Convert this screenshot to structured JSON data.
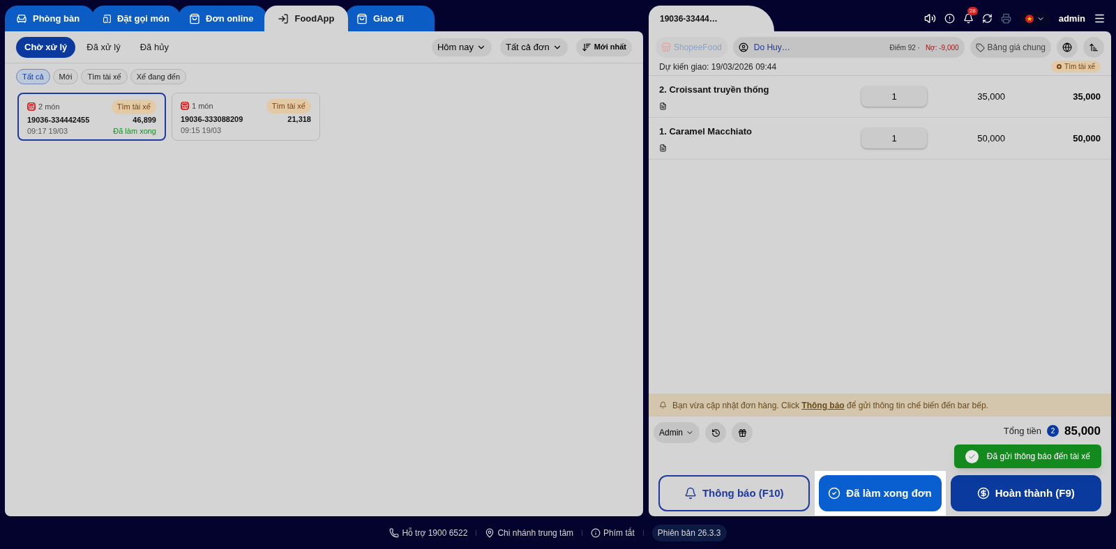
{
  "tabs": [
    {
      "label": "Phòng bàn",
      "selected": false
    },
    {
      "label": "Đặt gọi món",
      "selected": false
    },
    {
      "label": "Đơn online",
      "selected": false
    },
    {
      "label": "FoodApp",
      "selected": true
    },
    {
      "label": "Giao đi",
      "selected": false
    }
  ],
  "status_tabs": [
    {
      "label": "Chờ xử lý",
      "selected": true
    },
    {
      "label": "Đã xử lý",
      "selected": false
    },
    {
      "label": "Đã hủy",
      "selected": false
    }
  ],
  "filters": {
    "date": "Hôm nay",
    "orders": "Tất cả đơn",
    "sort": "Mới nhất"
  },
  "chips": [
    {
      "label": "Tất cả",
      "selected": true
    },
    {
      "label": "Mới",
      "selected": false
    },
    {
      "label": "Tìm tài xế",
      "selected": false
    },
    {
      "label": "Xế đang đến",
      "selected": false
    }
  ],
  "orders": [
    {
      "items": "2 món",
      "badge": "Tìm tài xế",
      "id": "19036-334442455",
      "amount": "46,899",
      "time": "09:17 19/03",
      "status": "Đã làm xong",
      "selected": true
    },
    {
      "items": "1 món",
      "badge": "Tìm tài xế",
      "id": "19036-333088209",
      "amount": "21,318",
      "time": "09:15 19/03",
      "selected": false
    }
  ],
  "order_tab": "19036-33444…",
  "header": {
    "notification_count": "28",
    "user": "admin"
  },
  "customer_bar": {
    "channel": "ShopeeFood",
    "customer": "Do Huy…",
    "points": "Điểm 92 ·",
    "debt": "Nợ: -9,000",
    "price_list": "Bảng giá chung"
  },
  "delivery": {
    "text": "Dự kiến giao: 19/03/2026 09:44",
    "status": "Tìm tài xế"
  },
  "items": [
    {
      "name": "2. Croissant truyền thống",
      "qty": "1",
      "price": "35,000",
      "total": "35,000"
    },
    {
      "name": "1. Caramel Macchiato",
      "qty": "1",
      "price": "50,000",
      "total": "50,000"
    }
  ],
  "notice": {
    "before": "Bạn vừa cập nhật đơn hàng. Click",
    "link": "Thông báo",
    "after": "để gửi thông tin chế biến đến bar bếp."
  },
  "staff": "Admin",
  "total": {
    "label": "Tổng tiền",
    "count": "2",
    "amount": "85,000"
  },
  "toast": "Đã gửi thông báo đến tài xế",
  "actions": [
    {
      "label": "Thông báo (F10)",
      "kind": "outline"
    },
    {
      "label": "Đã làm xong đơn",
      "kind": "highlight"
    },
    {
      "label": "Hoàn thành (F9)",
      "kind": "primary"
    }
  ],
  "footer": [
    {
      "label": "Hỗ trợ 1900 6522",
      "kind": "link"
    },
    {
      "label": "Chi nhánh trung tâm",
      "kind": "link"
    },
    {
      "label": "Phím tắt",
      "kind": "link"
    },
    {
      "label": "Phiên bản 26.3.3",
      "kind": "version"
    }
  ]
}
